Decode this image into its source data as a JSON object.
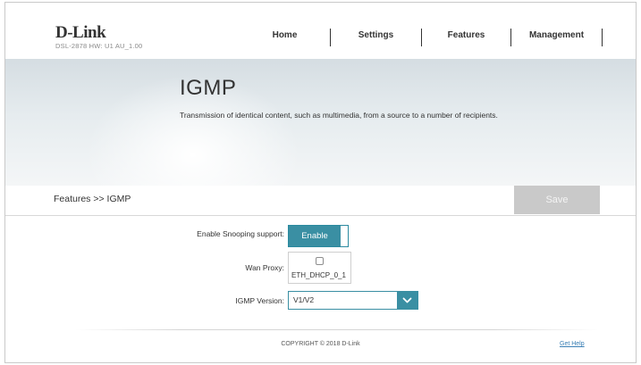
{
  "brand": {
    "logo": "D-Link",
    "model_info": "DSL-2878  HW: U1  AU_1.00"
  },
  "nav": {
    "home": "Home",
    "settings": "Settings",
    "features": "Features",
    "management": "Management"
  },
  "banner": {
    "title": "IGMP",
    "description": "Transmission of identical content, such as multimedia, from a source to a number of recipients."
  },
  "breadcrumb": "Features >> IGMP",
  "toolbar": {
    "save_label": "Save",
    "save_enabled": false
  },
  "form": {
    "snooping_label": "Enable Snooping support:",
    "snooping_button": "Enable",
    "wan_proxy_label": "Wan Proxy:",
    "wan_proxy_checked": false,
    "wan_proxy_interface": "ETH_DHCP_0_1",
    "igmp_version_label": "IGMP Version:",
    "igmp_version_value": "V1/V2"
  },
  "footer": {
    "copyright": "COPYRIGHT © 2018 D-Link",
    "help_link": "Get Help"
  },
  "colors": {
    "accent": "#3a8fa3",
    "save_disabled": "#c9c9c9",
    "link": "#3a7fb5"
  },
  "icons": {
    "dropdown": "chevron-down-icon"
  }
}
